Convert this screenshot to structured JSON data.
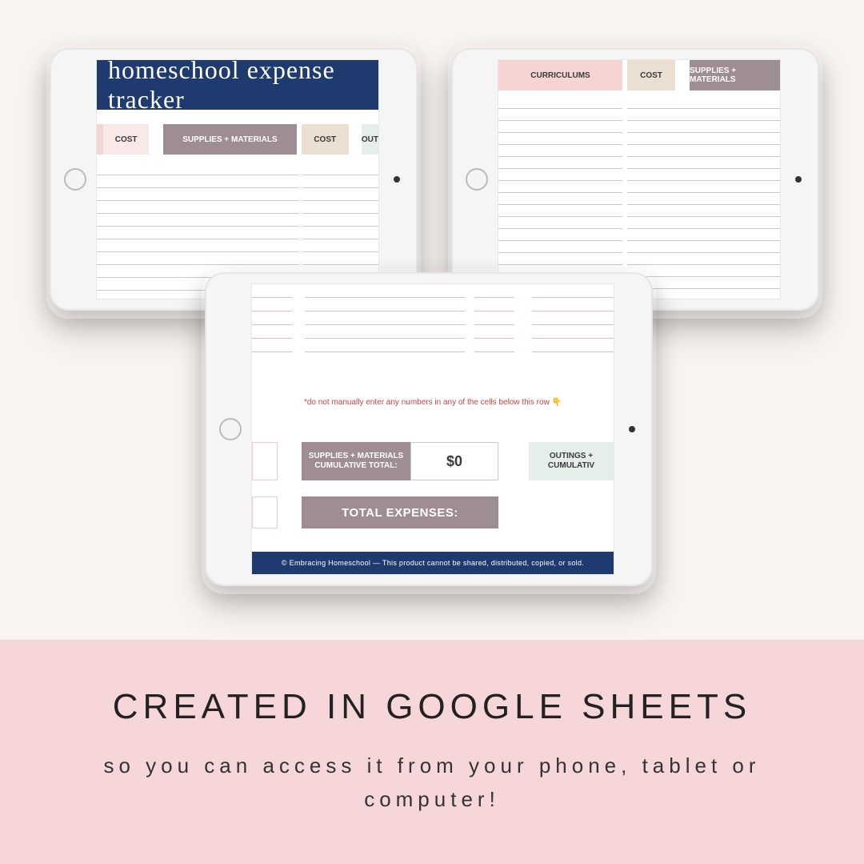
{
  "colors": {
    "bg": "#f9f4f1",
    "panel": "#f7d6da",
    "navy": "#1e3a6e",
    "mauve": "#9e8e94",
    "pink": "#f7d4d4",
    "tan": "#eadfd0",
    "mint": "#e5eee9"
  },
  "left": {
    "title": "homeschool expense tracker",
    "cols": {
      "cost1": "COST",
      "supplies": "SUPPLIES + MATERIALS",
      "cost2": "COST",
      "out": "OUT"
    },
    "blank_rows": 10
  },
  "right": {
    "cols": {
      "curriculums": "CURRICULUMS",
      "cost": "COST",
      "supplies": "SUPPLIES + MATERIALS"
    },
    "blank_rows": 16
  },
  "middle": {
    "warning": "*do not manually enter any numbers in any of the cells below this row 👇",
    "supplies_total_label_1": "SUPPLIES + MATERIALS",
    "supplies_total_label_2": "CUMULATIVE TOTAL:",
    "supplies_total_value": "$0",
    "outings_label_1": "OUTINGS +",
    "outings_label_2": "CUMULATIV",
    "total_expenses_label": "TOTAL EXPENSES:",
    "footer": "© Embracing Homeschool — This product cannot be shared, distributed, copied, or sold.",
    "top_rows": 5
  },
  "bottom": {
    "title": "CREATED IN GOOGLE SHEETS",
    "subtitle": "so you can access it from your phone, tablet or computer!"
  }
}
